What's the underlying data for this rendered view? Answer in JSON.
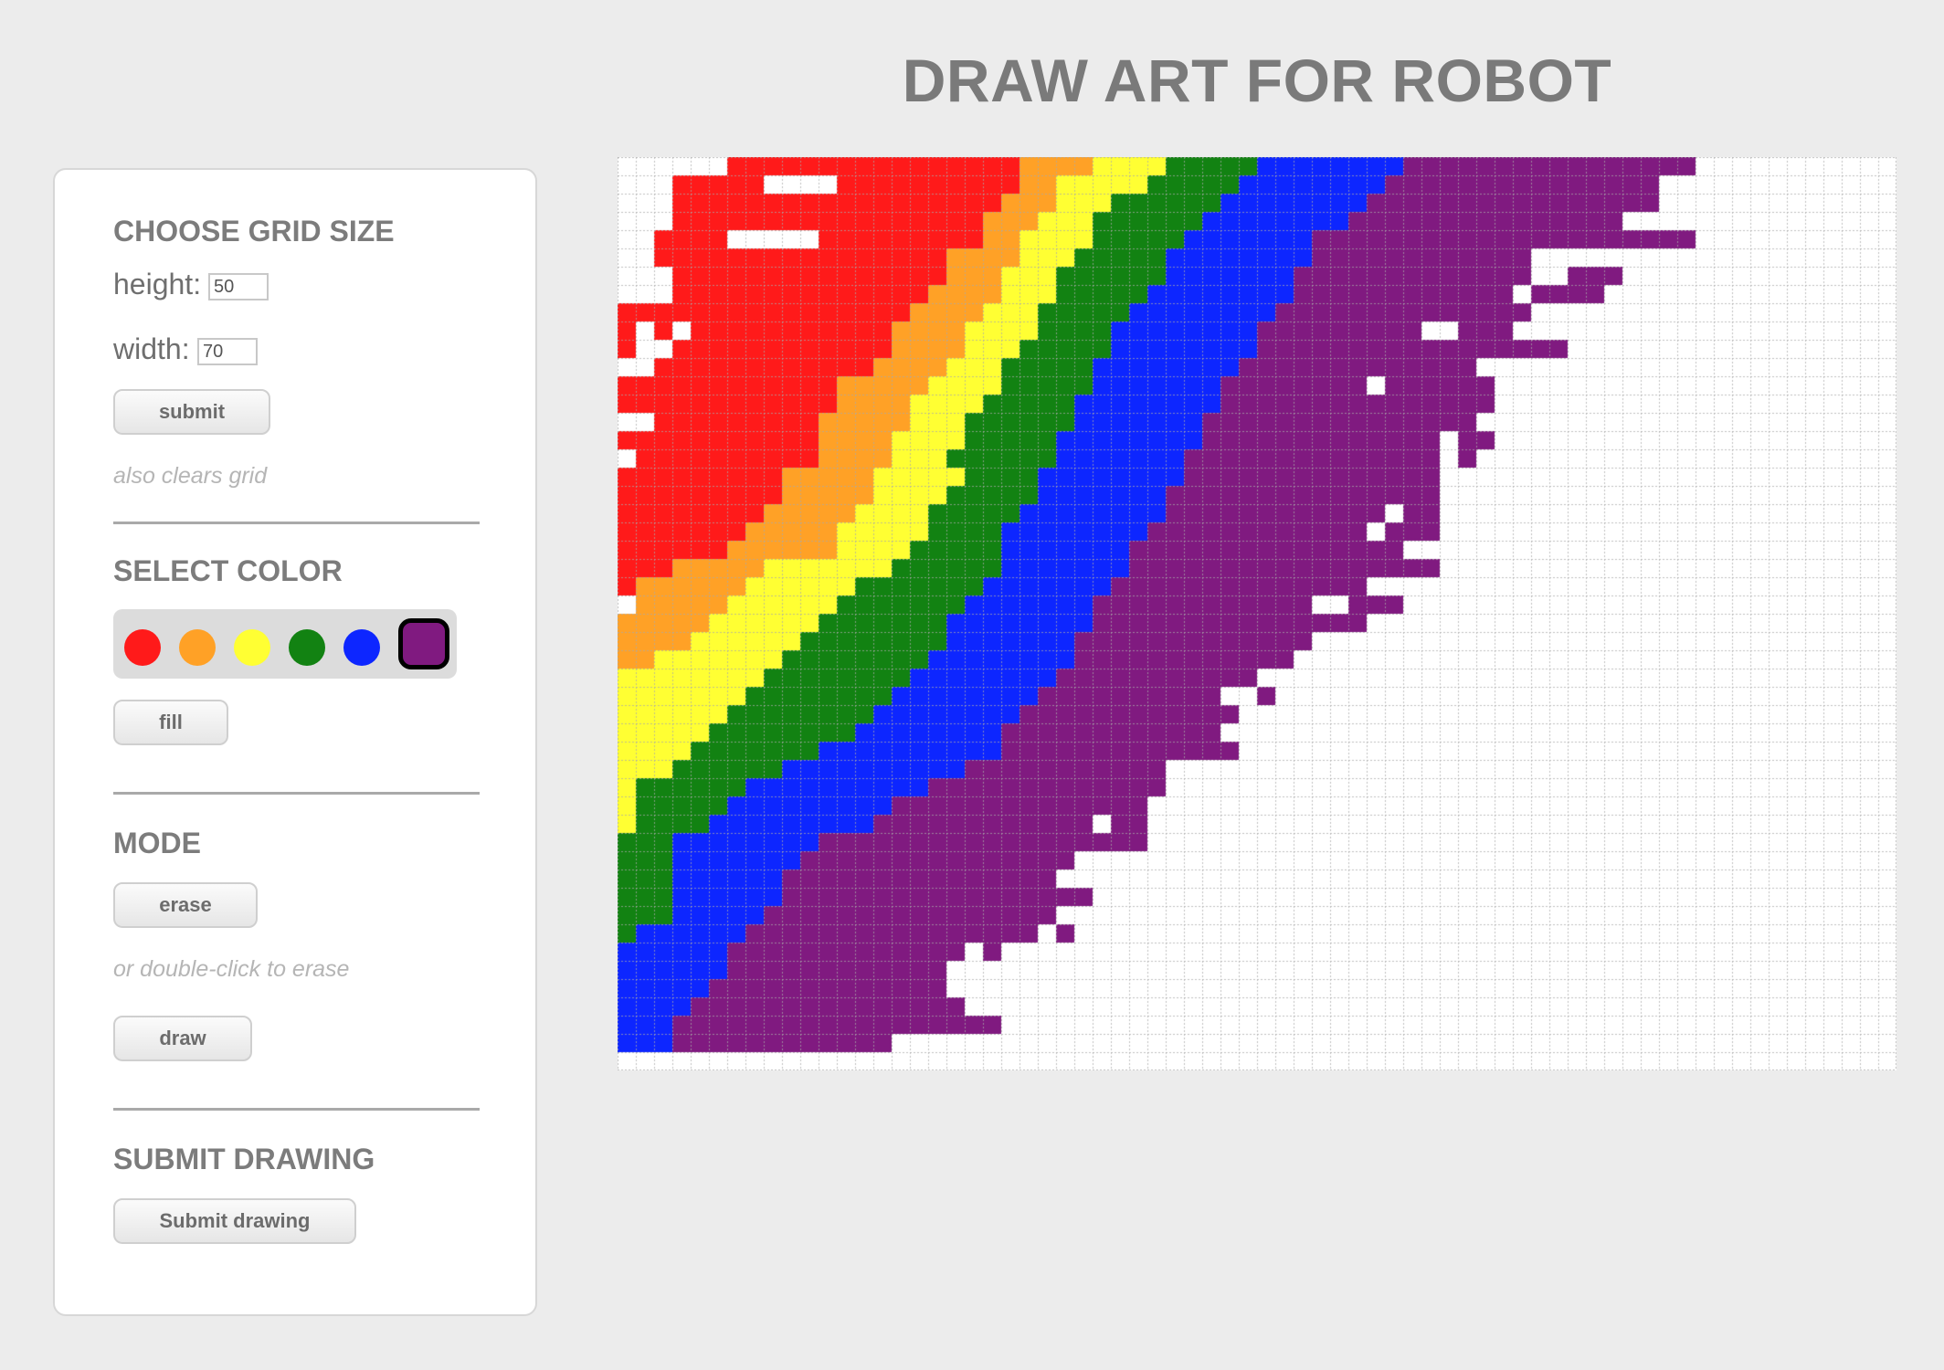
{
  "header": {
    "title": "DRAW ART FOR ROBOT"
  },
  "grid_size": {
    "heading": "CHOOSE GRID SIZE",
    "height_label": "height:",
    "height_value": "50",
    "width_label": "width:",
    "width_value": "70",
    "submit_label": "submit",
    "hint": "also clears grid"
  },
  "select_color": {
    "heading": "SELECT COLOR",
    "colors": [
      {
        "name": "red",
        "hex": "#ff1a1a"
      },
      {
        "name": "orange",
        "hex": "#ffa126"
      },
      {
        "name": "yellow",
        "hex": "#ffff33"
      },
      {
        "name": "green",
        "hex": "#128212"
      },
      {
        "name": "blue",
        "hex": "#0d26ff"
      },
      {
        "name": "purple",
        "hex": "#801a80"
      }
    ],
    "selected_color": "purple",
    "fill_label": "fill"
  },
  "mode": {
    "heading": "MODE",
    "erase_label": "erase",
    "erase_hint": "or double-click to erase",
    "draw_label": "draw"
  },
  "submit_drawing": {
    "heading": "SUBMIT DRAWING",
    "button_label": "Submit drawing"
  },
  "canvas": {
    "rows": 50,
    "cols": 70,
    "row_order": "top to bottom",
    "run_format": "[start column, length, color] runs of filled cells per row; unlisted cells are blank",
    "colors": {
      "R": "#ff1a1a",
      "O": "#ffa126",
      "Y": "#ffff33",
      "G": "#128212",
      "B": "#0d26ff",
      "P": "#801a80"
    },
    "rows_data": [
      [
        [
          6,
          16,
          "R"
        ],
        [
          22,
          4,
          "O"
        ],
        [
          26,
          4,
          "Y"
        ],
        [
          30,
          5,
          "G"
        ],
        [
          35,
          8,
          "B"
        ],
        [
          43,
          16,
          "P"
        ]
      ],
      [
        [
          3,
          5,
          "R"
        ],
        [
          12,
          10,
          "R"
        ],
        [
          22,
          2,
          "O"
        ],
        [
          24,
          5,
          "Y"
        ],
        [
          29,
          5,
          "G"
        ],
        [
          34,
          8,
          "B"
        ],
        [
          42,
          15,
          "P"
        ]
      ],
      [
        [
          3,
          18,
          "R"
        ],
        [
          21,
          3,
          "O"
        ],
        [
          24,
          3,
          "Y"
        ],
        [
          27,
          6,
          "G"
        ],
        [
          33,
          8,
          "B"
        ],
        [
          41,
          16,
          "P"
        ]
      ],
      [
        [
          3,
          17,
          "R"
        ],
        [
          20,
          3,
          "O"
        ],
        [
          23,
          3,
          "Y"
        ],
        [
          26,
          6,
          "G"
        ],
        [
          32,
          8,
          "B"
        ],
        [
          40,
          15,
          "P"
        ]
      ],
      [
        [
          2,
          4,
          "R"
        ],
        [
          11,
          9,
          "R"
        ],
        [
          20,
          2,
          "O"
        ],
        [
          22,
          4,
          "Y"
        ],
        [
          26,
          5,
          "G"
        ],
        [
          31,
          7,
          "B"
        ],
        [
          38,
          21,
          "P"
        ]
      ],
      [
        [
          2,
          16,
          "R"
        ],
        [
          18,
          4,
          "O"
        ],
        [
          22,
          3,
          "Y"
        ],
        [
          25,
          5,
          "G"
        ],
        [
          30,
          8,
          "B"
        ],
        [
          38,
          12,
          "P"
        ]
      ],
      [
        [
          3,
          15,
          "R"
        ],
        [
          18,
          3,
          "O"
        ],
        [
          21,
          3,
          "Y"
        ],
        [
          24,
          6,
          "G"
        ],
        [
          30,
          7,
          "B"
        ],
        [
          37,
          13,
          "P"
        ],
        [
          52,
          3,
          "P"
        ]
      ],
      [
        [
          3,
          14,
          "R"
        ],
        [
          17,
          4,
          "O"
        ],
        [
          21,
          3,
          "Y"
        ],
        [
          24,
          5,
          "G"
        ],
        [
          29,
          8,
          "B"
        ],
        [
          37,
          12,
          "P"
        ],
        [
          50,
          4,
          "P"
        ]
      ],
      [
        [
          0,
          3,
          "R"
        ],
        [
          3,
          13,
          "R"
        ],
        [
          16,
          4,
          "O"
        ],
        [
          20,
          3,
          "Y"
        ],
        [
          23,
          5,
          "G"
        ],
        [
          28,
          8,
          "B"
        ],
        [
          36,
          14,
          "P"
        ]
      ],
      [
        [
          0,
          1,
          "R"
        ],
        [
          2,
          1,
          "R"
        ],
        [
          4,
          11,
          "R"
        ],
        [
          15,
          4,
          "O"
        ],
        [
          19,
          4,
          "Y"
        ],
        [
          23,
          4,
          "G"
        ],
        [
          27,
          8,
          "B"
        ],
        [
          35,
          9,
          "P"
        ],
        [
          46,
          3,
          "P"
        ]
      ],
      [
        [
          0,
          1,
          "R"
        ],
        [
          3,
          12,
          "R"
        ],
        [
          15,
          4,
          "O"
        ],
        [
          19,
          3,
          "Y"
        ],
        [
          22,
          5,
          "G"
        ],
        [
          27,
          8,
          "B"
        ],
        [
          35,
          17,
          "P"
        ]
      ],
      [
        [
          2,
          12,
          "R"
        ],
        [
          14,
          4,
          "O"
        ],
        [
          18,
          3,
          "Y"
        ],
        [
          21,
          5,
          "G"
        ],
        [
          26,
          8,
          "B"
        ],
        [
          34,
          13,
          "P"
        ]
      ],
      [
        [
          0,
          12,
          "R"
        ],
        [
          12,
          5,
          "O"
        ],
        [
          17,
          4,
          "Y"
        ],
        [
          21,
          5,
          "G"
        ],
        [
          26,
          7,
          "B"
        ],
        [
          33,
          8,
          "P"
        ],
        [
          42,
          6,
          "P"
        ]
      ],
      [
        [
          0,
          2,
          "R"
        ],
        [
          2,
          10,
          "R"
        ],
        [
          12,
          4,
          "O"
        ],
        [
          16,
          4,
          "Y"
        ],
        [
          20,
          5,
          "G"
        ],
        [
          25,
          8,
          "B"
        ],
        [
          33,
          15,
          "P"
        ]
      ],
      [
        [
          2,
          9,
          "R"
        ],
        [
          11,
          5,
          "O"
        ],
        [
          16,
          3,
          "Y"
        ],
        [
          19,
          6,
          "G"
        ],
        [
          25,
          7,
          "B"
        ],
        [
          32,
          15,
          "P"
        ]
      ],
      [
        [
          0,
          11,
          "R"
        ],
        [
          11,
          4,
          "O"
        ],
        [
          15,
          4,
          "Y"
        ],
        [
          19,
          5,
          "G"
        ],
        [
          24,
          8,
          "B"
        ],
        [
          32,
          13,
          "P"
        ],
        [
          46,
          2,
          "P"
        ]
      ],
      [
        [
          1,
          10,
          "R"
        ],
        [
          11,
          4,
          "O"
        ],
        [
          15,
          3,
          "Y"
        ],
        [
          18,
          6,
          "G"
        ],
        [
          24,
          7,
          "B"
        ],
        [
          31,
          14,
          "P"
        ],
        [
          46,
          1,
          "P"
        ]
      ],
      [
        [
          0,
          9,
          "R"
        ],
        [
          9,
          5,
          "O"
        ],
        [
          14,
          5,
          "Y"
        ],
        [
          19,
          4,
          "G"
        ],
        [
          23,
          8,
          "B"
        ],
        [
          31,
          14,
          "P"
        ]
      ],
      [
        [
          0,
          9,
          "R"
        ],
        [
          9,
          5,
          "O"
        ],
        [
          14,
          4,
          "Y"
        ],
        [
          18,
          5,
          "G"
        ],
        [
          23,
          7,
          "B"
        ],
        [
          30,
          15,
          "P"
        ]
      ],
      [
        [
          0,
          8,
          "R"
        ],
        [
          8,
          5,
          "O"
        ],
        [
          13,
          4,
          "Y"
        ],
        [
          17,
          5,
          "G"
        ],
        [
          22,
          8,
          "B"
        ],
        [
          30,
          12,
          "P"
        ],
        [
          43,
          2,
          "P"
        ]
      ],
      [
        [
          0,
          7,
          "R"
        ],
        [
          7,
          5,
          "O"
        ],
        [
          12,
          5,
          "Y"
        ],
        [
          17,
          4,
          "G"
        ],
        [
          21,
          8,
          "B"
        ],
        [
          29,
          12,
          "P"
        ],
        [
          42,
          3,
          "P"
        ]
      ],
      [
        [
          0,
          6,
          "R"
        ],
        [
          6,
          6,
          "O"
        ],
        [
          12,
          4,
          "Y"
        ],
        [
          16,
          5,
          "G"
        ],
        [
          21,
          7,
          "B"
        ],
        [
          28,
          15,
          "P"
        ]
      ],
      [
        [
          0,
          3,
          "R"
        ],
        [
          3,
          5,
          "O"
        ],
        [
          8,
          7,
          "Y"
        ],
        [
          15,
          6,
          "G"
        ],
        [
          21,
          7,
          "B"
        ],
        [
          28,
          17,
          "P"
        ]
      ],
      [
        [
          0,
          1,
          "R"
        ],
        [
          1,
          6,
          "O"
        ],
        [
          7,
          6,
          "Y"
        ],
        [
          13,
          7,
          "G"
        ],
        [
          20,
          7,
          "B"
        ],
        [
          27,
          14,
          "P"
        ]
      ],
      [
        [
          1,
          5,
          "O"
        ],
        [
          6,
          6,
          "Y"
        ],
        [
          12,
          7,
          "G"
        ],
        [
          19,
          7,
          "B"
        ],
        [
          26,
          12,
          "P"
        ],
        [
          40,
          3,
          "P"
        ]
      ],
      [
        [
          0,
          5,
          "O"
        ],
        [
          5,
          6,
          "Y"
        ],
        [
          11,
          7,
          "G"
        ],
        [
          18,
          8,
          "B"
        ],
        [
          26,
          15,
          "P"
        ]
      ],
      [
        [
          0,
          4,
          "O"
        ],
        [
          4,
          6,
          "Y"
        ],
        [
          10,
          8,
          "G"
        ],
        [
          18,
          7,
          "B"
        ],
        [
          25,
          13,
          "P"
        ]
      ],
      [
        [
          0,
          2,
          "O"
        ],
        [
          2,
          7,
          "Y"
        ],
        [
          9,
          8,
          "G"
        ],
        [
          17,
          8,
          "B"
        ],
        [
          25,
          12,
          "P"
        ]
      ],
      [
        [
          0,
          8,
          "Y"
        ],
        [
          8,
          8,
          "G"
        ],
        [
          16,
          8,
          "B"
        ],
        [
          24,
          11,
          "P"
        ]
      ],
      [
        [
          0,
          7,
          "Y"
        ],
        [
          7,
          8,
          "G"
        ],
        [
          15,
          8,
          "B"
        ],
        [
          23,
          10,
          "P"
        ],
        [
          35,
          1,
          "P"
        ]
      ],
      [
        [
          0,
          6,
          "Y"
        ],
        [
          6,
          8,
          "G"
        ],
        [
          14,
          8,
          "B"
        ],
        [
          22,
          12,
          "P"
        ]
      ],
      [
        [
          0,
          5,
          "Y"
        ],
        [
          5,
          8,
          "G"
        ],
        [
          13,
          8,
          "B"
        ],
        [
          21,
          12,
          "P"
        ]
      ],
      [
        [
          0,
          4,
          "Y"
        ],
        [
          4,
          7,
          "G"
        ],
        [
          11,
          10,
          "B"
        ],
        [
          21,
          13,
          "P"
        ]
      ],
      [
        [
          0,
          3,
          "Y"
        ],
        [
          3,
          6,
          "G"
        ],
        [
          9,
          10,
          "B"
        ],
        [
          19,
          11,
          "P"
        ]
      ],
      [
        [
          0,
          1,
          "Y"
        ],
        [
          1,
          6,
          "G"
        ],
        [
          7,
          10,
          "B"
        ],
        [
          17,
          13,
          "P"
        ]
      ],
      [
        [
          0,
          1,
          "Y"
        ],
        [
          1,
          5,
          "G"
        ],
        [
          6,
          9,
          "B"
        ],
        [
          15,
          10,
          "P"
        ],
        [
          25,
          4,
          "P"
        ]
      ],
      [
        [
          0,
          1,
          "Y"
        ],
        [
          1,
          4,
          "G"
        ],
        [
          5,
          9,
          "B"
        ],
        [
          14,
          12,
          "P"
        ],
        [
          27,
          2,
          "P"
        ]
      ],
      [
        [
          0,
          3,
          "G"
        ],
        [
          3,
          8,
          "B"
        ],
        [
          11,
          12,
          "P"
        ],
        [
          23,
          6,
          "P"
        ]
      ],
      [
        [
          0,
          3,
          "G"
        ],
        [
          3,
          7,
          "B"
        ],
        [
          10,
          15,
          "P"
        ]
      ],
      [
        [
          0,
          3,
          "G"
        ],
        [
          3,
          6,
          "B"
        ],
        [
          9,
          15,
          "P"
        ]
      ],
      [
        [
          0,
          3,
          "G"
        ],
        [
          3,
          6,
          "B"
        ],
        [
          9,
          17,
          "P"
        ]
      ],
      [
        [
          0,
          3,
          "G"
        ],
        [
          3,
          5,
          "B"
        ],
        [
          8,
          16,
          "P"
        ]
      ],
      [
        [
          0,
          1,
          "G"
        ],
        [
          1,
          6,
          "B"
        ],
        [
          7,
          16,
          "P"
        ],
        [
          24,
          1,
          "P"
        ]
      ],
      [
        [
          0,
          6,
          "B"
        ],
        [
          6,
          13,
          "P"
        ],
        [
          20,
          1,
          "P"
        ]
      ],
      [
        [
          0,
          6,
          "B"
        ],
        [
          6,
          12,
          "P"
        ]
      ],
      [
        [
          0,
          5,
          "B"
        ],
        [
          5,
          13,
          "P"
        ]
      ],
      [
        [
          0,
          4,
          "B"
        ],
        [
          4,
          15,
          "P"
        ]
      ],
      [
        [
          0,
          3,
          "B"
        ],
        [
          3,
          18,
          "P"
        ]
      ],
      [
        [
          0,
          3,
          "B"
        ],
        [
          3,
          12,
          "P"
        ]
      ],
      []
    ]
  }
}
